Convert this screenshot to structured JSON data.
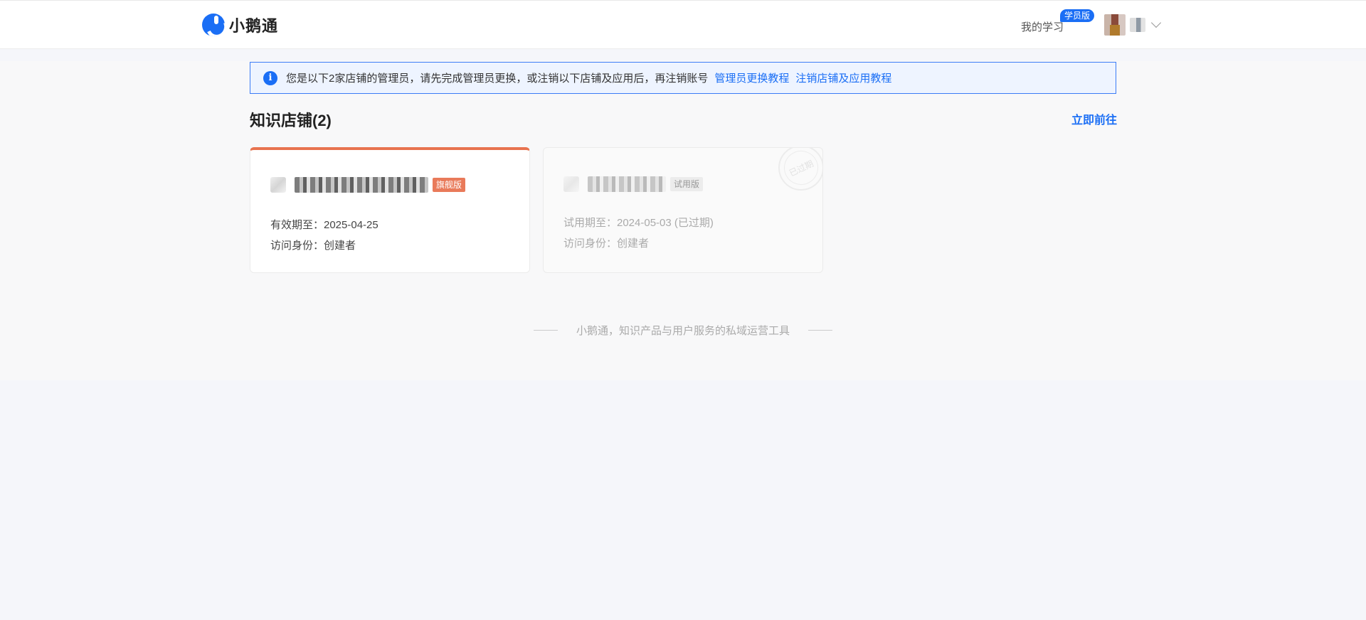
{
  "header": {
    "logo_text": "小鹅通",
    "my_learning": "我的学习",
    "student_badge": "学员版"
  },
  "notice": {
    "message": "您是以下2家店铺的管理员，请先完成管理员更换，或注销以下店铺及应用后，再注销账号",
    "link_admin_change": "管理员更换教程",
    "link_cancel_shop": "注销店铺及应用教程",
    "icon": "info-icon"
  },
  "section": {
    "title": "知识店铺(2)",
    "go_now": "立即前往"
  },
  "shops": [
    {
      "edition": "旗舰版",
      "expiry_line": "有效期至：2025-04-25",
      "role_line": "访问身份：创建者"
    },
    {
      "edition": "试用版",
      "expiry_line": "试用期至：2024-05-03 (已过期)",
      "role_line": "访问身份：创建者",
      "stamp": "已过期"
    }
  ],
  "footer": {
    "slogan": "小鹅通，知识产品与用户服务的私域运营工具"
  },
  "colors": {
    "accent": "#1a6ef5",
    "flagship": "#e8734f",
    "notice_bg": "#eef4ff"
  }
}
